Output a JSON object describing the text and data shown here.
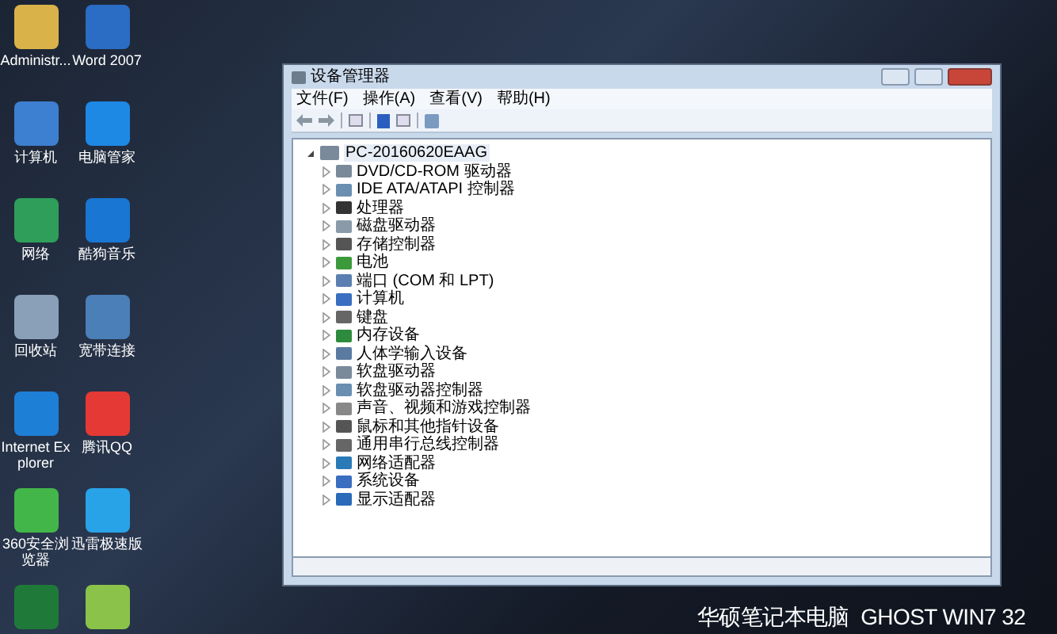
{
  "desktop_icons": [
    {
      "label": "Administr..."
    },
    {
      "label": "Word 2007"
    },
    {
      "label": "计算机"
    },
    {
      "label": "电脑管家"
    },
    {
      "label": "网络"
    },
    {
      "label": "酷狗音乐"
    },
    {
      "label": "回收站"
    },
    {
      "label": "宽带连接"
    },
    {
      "label": "Internet Explorer"
    },
    {
      "label": "腾讯QQ"
    },
    {
      "label": "360安全浏览器"
    },
    {
      "label": "迅雷极速版"
    }
  ],
  "window": {
    "title": "设备管理器",
    "menu": [
      "文件(F)",
      "操作(A)",
      "查看(V)",
      "帮助(H)"
    ],
    "tree": {
      "label": "PC-20160620EAAG",
      "expanded": true,
      "selected": true,
      "children": [
        {
          "label": "DVD/CD-ROM 驱动器",
          "expanded": false
        },
        {
          "label": "IDE ATA/ATAPI 控制器",
          "expanded": false
        },
        {
          "label": "处理器",
          "expanded": false
        },
        {
          "label": "磁盘驱动器",
          "expanded": false
        },
        {
          "label": "存储控制器",
          "expanded": false
        },
        {
          "label": "电池",
          "expanded": false
        },
        {
          "label": "端口 (COM 和 LPT)",
          "expanded": false
        },
        {
          "label": "计算机",
          "expanded": false
        },
        {
          "label": "键盘",
          "expanded": false
        },
        {
          "label": "内存设备",
          "expanded": false
        },
        {
          "label": "人体学输入设备",
          "expanded": false
        },
        {
          "label": "软盘驱动器",
          "expanded": false
        },
        {
          "label": "软盘驱动器控制器",
          "expanded": false
        },
        {
          "label": "声音、视频和游戏控制器",
          "expanded": false
        },
        {
          "label": "鼠标和其他指针设备",
          "expanded": false
        },
        {
          "label": "通用串行总线控制器",
          "expanded": false
        },
        {
          "label": "网络适配器",
          "expanded": false
        },
        {
          "label": "系统设备",
          "expanded": false
        },
        {
          "label": "显示适配器",
          "expanded": false
        }
      ]
    }
  },
  "caption": "华硕笔记本电脑  GHOST WIN7 32"
}
